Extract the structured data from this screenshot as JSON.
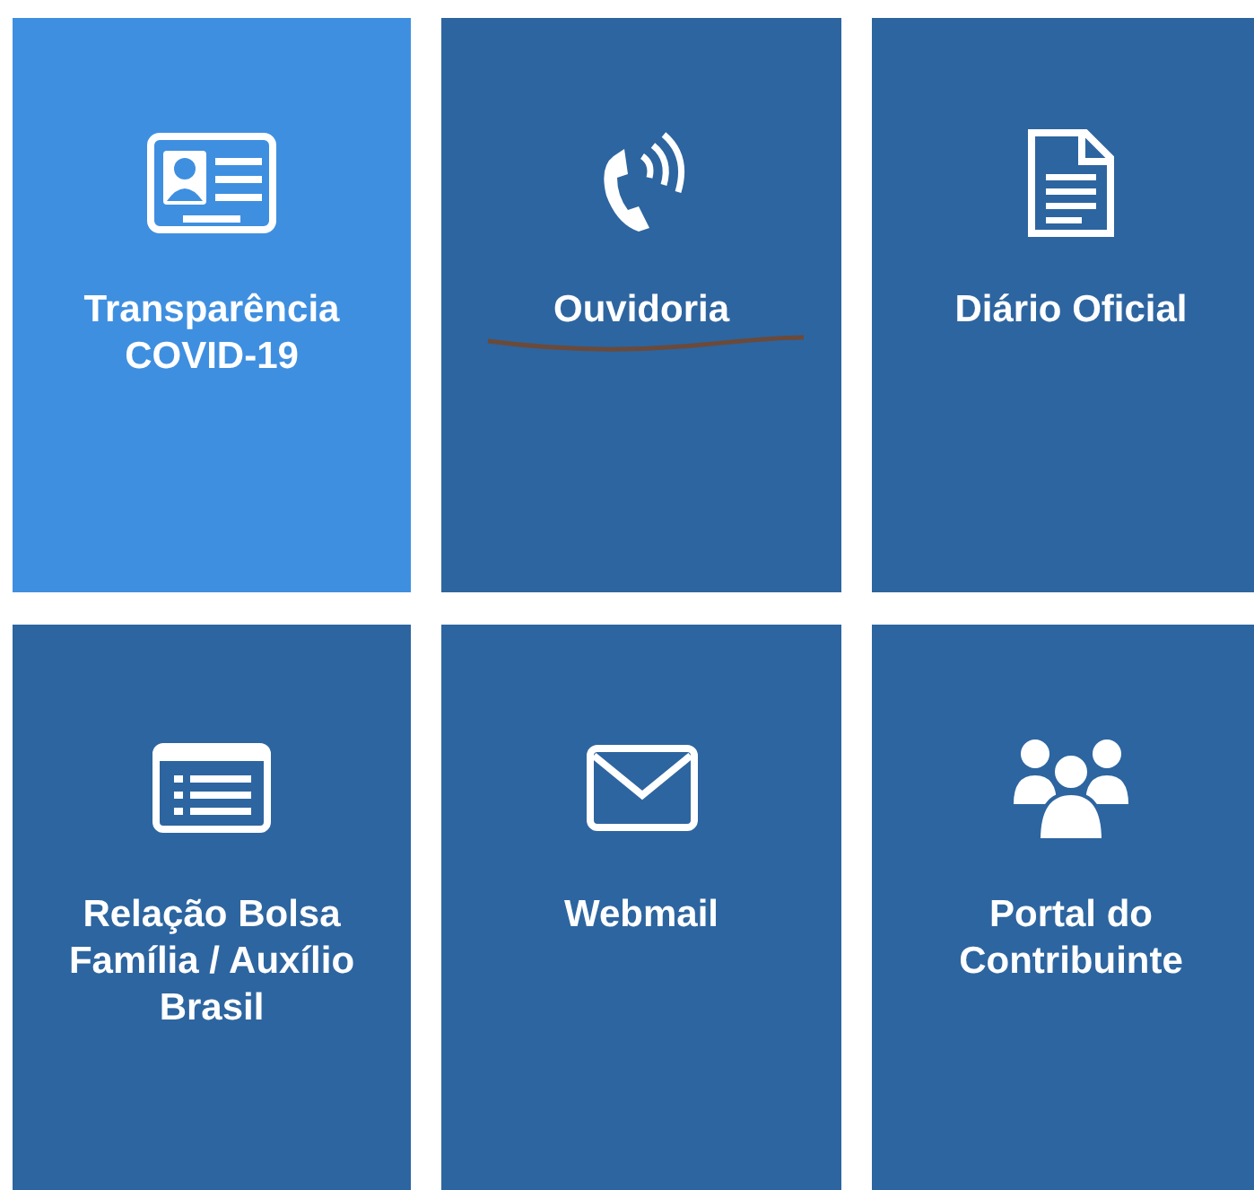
{
  "tiles": [
    {
      "label": "Transparência COVID-19",
      "highlighted": true,
      "underlined": false
    },
    {
      "label": "Ouvidoria",
      "highlighted": false,
      "underlined": true
    },
    {
      "label": "Diário Oficial",
      "highlighted": false,
      "underlined": false
    },
    {
      "label": "Relação Bolsa Família / Auxílio Brasil",
      "highlighted": false,
      "underlined": false
    },
    {
      "label": "Webmail",
      "highlighted": false,
      "underlined": false
    },
    {
      "label": "Portal do Contribuinte",
      "highlighted": false,
      "underlined": false
    }
  ]
}
